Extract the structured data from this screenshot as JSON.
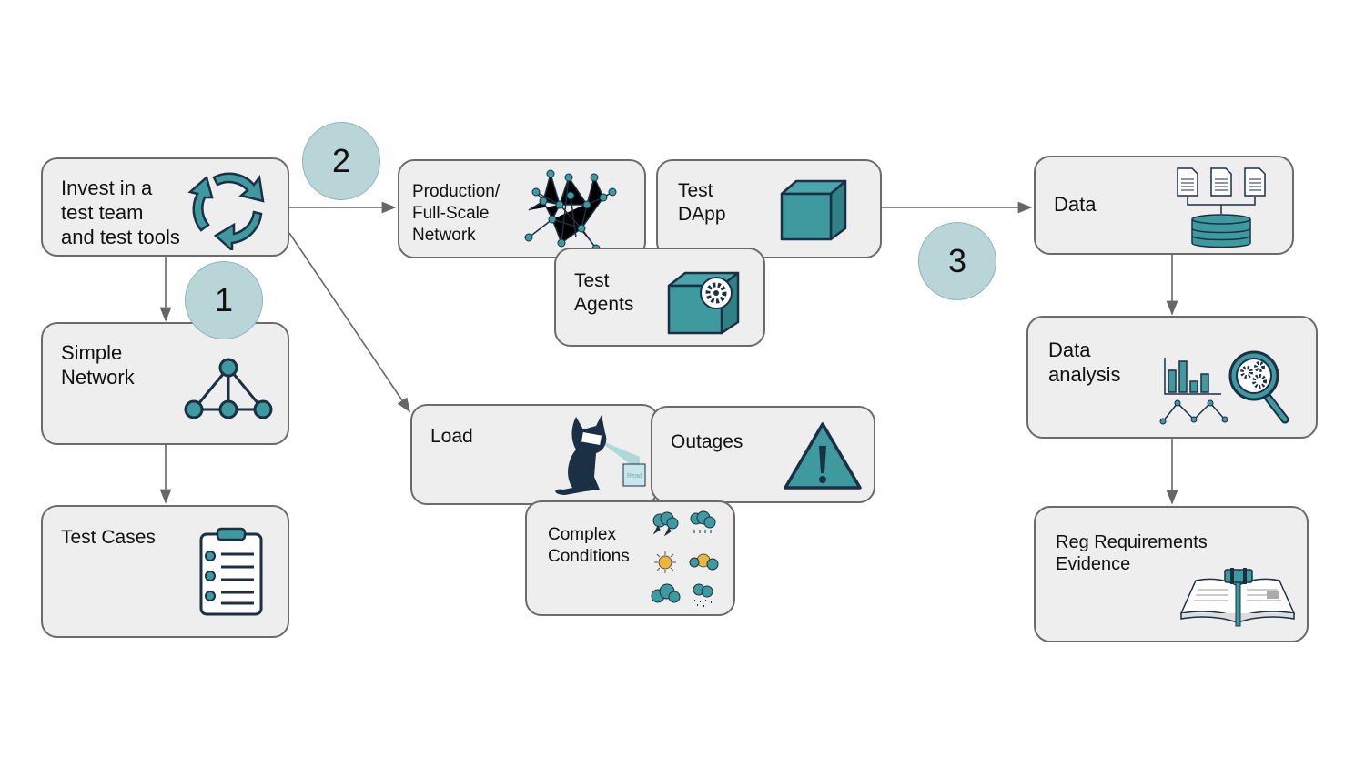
{
  "colors": {
    "box_fill": "#eeeeee",
    "box_border": "#6b6b6b",
    "teal": "#3f9aa0",
    "navy": "#1b2f45",
    "badge_fill": "#b9d5d7",
    "arrow": "#666666"
  },
  "badges": [
    "1",
    "2",
    "3"
  ],
  "boxes": {
    "invest": {
      "label": "Invest in a\ntest team\nand test tools",
      "icon": "cycle-arrows-icon"
    },
    "simple_network": {
      "label": "Simple\nNetwork",
      "icon": "network-graph-icon"
    },
    "test_cases": {
      "label": "Test Cases",
      "icon": "clipboard-checklist-icon"
    },
    "production": {
      "label": "Production/\nFull-Scale\nNetwork",
      "icon": "mesh-network-icon"
    },
    "test_dapp": {
      "label": "Test\nDApp",
      "icon": "cube-icon"
    },
    "test_agents": {
      "label": "Test\nAgents",
      "icon": "cube-gear-icon"
    },
    "load": {
      "label": "Load",
      "icon": "cat-reading-icon",
      "icon_text": "Read"
    },
    "outages": {
      "label": "Outages",
      "icon": "warning-icon"
    },
    "complex": {
      "label": "Complex\nConditions",
      "icon": "weather-icons"
    },
    "data": {
      "label": "Data",
      "icon": "documents-database-icon"
    },
    "data_analysis": {
      "label": "Data\nanalysis",
      "icon": "charts-magnifier-icon"
    },
    "reg": {
      "label": "Reg Requirements\nEvidence",
      "icon": "book-gavel-icon"
    }
  }
}
